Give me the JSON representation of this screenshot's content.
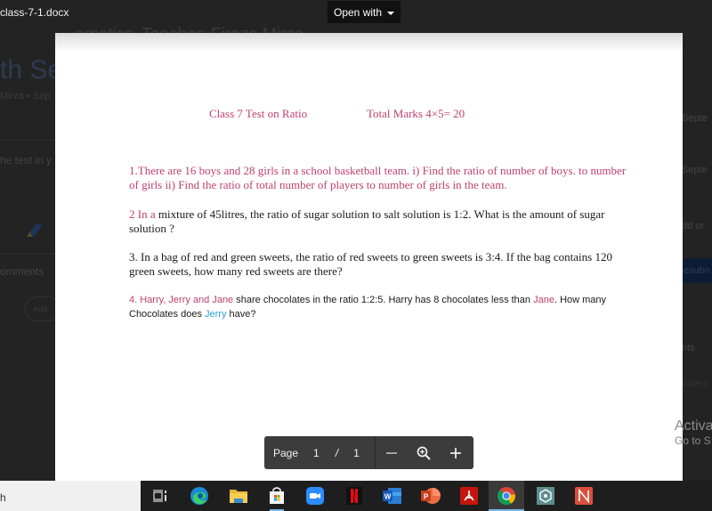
{
  "background": {
    "title_fragment": "ematics, Teacher: Firoza Mirza",
    "heading_fragment": "th Se",
    "subtitle_fragment": "Mirza • Sep",
    "body_fragment": "he  test in y",
    "comments_fragment": "omments",
    "comment_placeholder_fragment": "Add",
    "right_items": [
      "Septe",
      "Septe",
      "dd or",
      "esubn",
      "nts",
      "vate c"
    ]
  },
  "viewer": {
    "file_name": "class-7-1.docx",
    "open_with_label": "Open with"
  },
  "document": {
    "header_title": "Class 7 Test on  Ratio",
    "header_marks": "Total Marks 4×5= 20",
    "q1": "1.There are 16 boys and 28 girls in a school basketball team. i) Find the ratio of number of boys. to number of girls ii) Find the ratio of total number of players to number of girls in the team.",
    "q2_prefix": "2 In a",
    "q2_body": " mixture of 45litres, the ratio of sugar solution to salt solution is 1:2. What is the amount of sugar solution  ?",
    "q3": "3.  In a bag of red and green sweets, the ratio of red sweets to green sweets is 3:4. If the bag contains 120 green sweets, how many red sweets are there?",
    "q4_names": "4. Harry, Jerry and Jane",
    "q4_mid": " share chocolates in the ratio 1:2:5.  Harry has 8  chocolates less than  ",
    "q4_jane": "Jane",
    "q4_how": ". How many Chocolates does ",
    "q4_jerry": "Jerry",
    "q4_end": " have?"
  },
  "pager": {
    "page_label": "Page",
    "current_page": "1",
    "separator": "/",
    "total_pages": "1"
  },
  "windows_watermark": {
    "line1": "Activa",
    "line2": "Go to S"
  },
  "taskbar": {
    "search_fragment": "h",
    "apps": [
      {
        "name": "task-view",
        "icon": "task-view-icon"
      },
      {
        "name": "edge",
        "icon": "edge-icon"
      },
      {
        "name": "file-explorer",
        "icon": "folder-icon"
      },
      {
        "name": "microsoft-store",
        "icon": "store-icon",
        "running": true
      },
      {
        "name": "zoom",
        "icon": "zoom-icon"
      },
      {
        "name": "netflix",
        "icon": "netflix-icon"
      },
      {
        "name": "word",
        "icon": "word-icon"
      },
      {
        "name": "powerpoint",
        "icon": "powerpoint-icon"
      },
      {
        "name": "acrobat",
        "icon": "acrobat-icon"
      },
      {
        "name": "chrome",
        "icon": "chrome-icon",
        "active": true
      },
      {
        "name": "app-hex",
        "icon": "hex-app-icon"
      },
      {
        "name": "app-red",
        "icon": "red-app-icon"
      }
    ]
  }
}
